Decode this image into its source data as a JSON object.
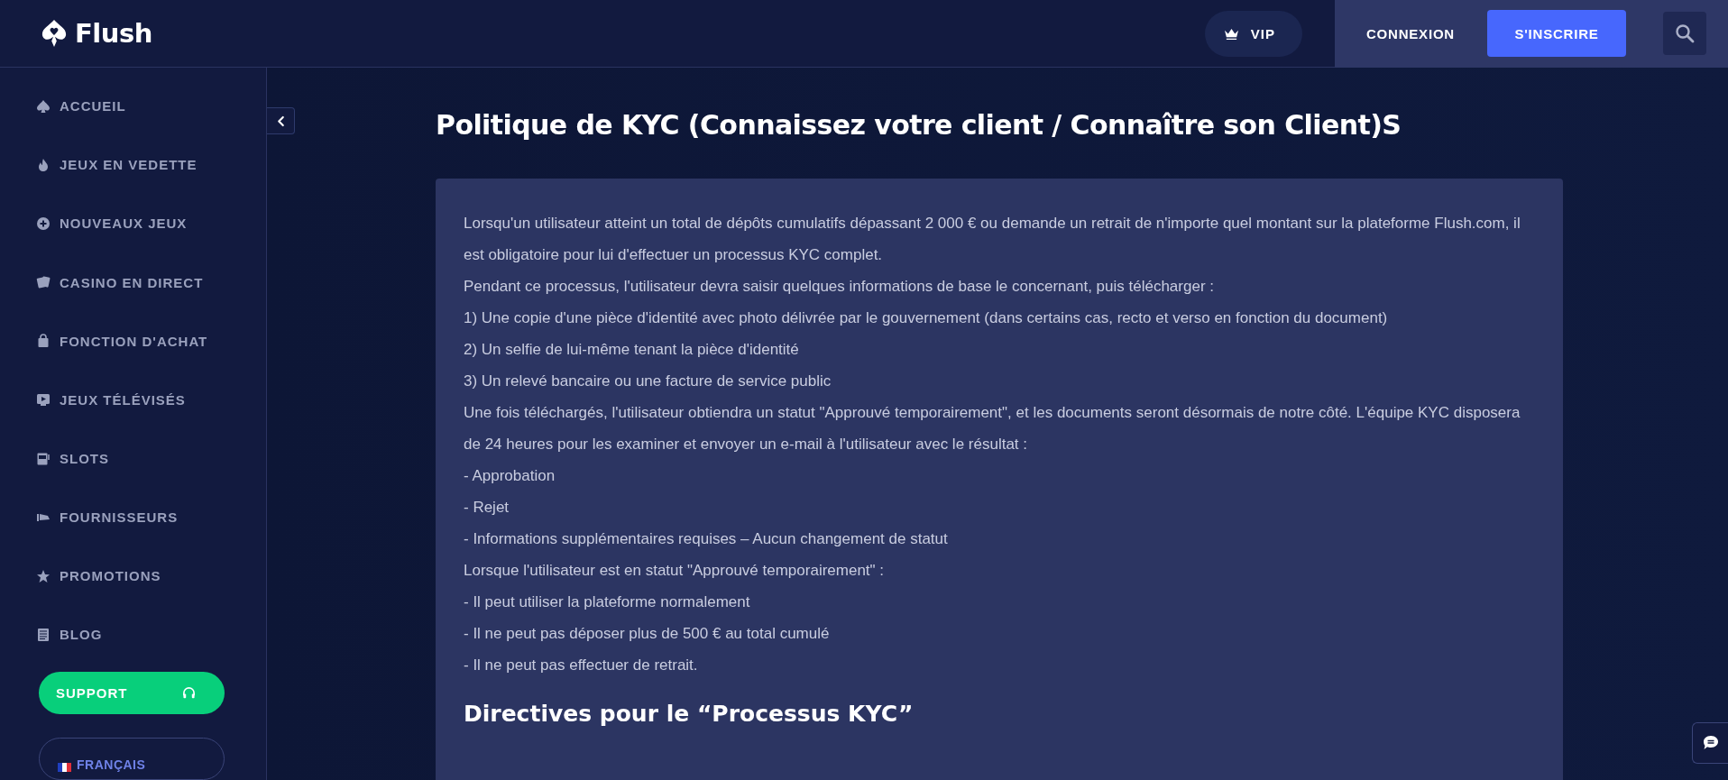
{
  "header": {
    "logo": "Flush",
    "vip": "VIP",
    "login": "CONNEXION",
    "signup": "S'INSCRIRE"
  },
  "sidebar": {
    "items": [
      {
        "label": "ACCUEIL"
      },
      {
        "label": "JEUX EN VEDETTE"
      },
      {
        "label": "NOUVEAUX JEUX"
      },
      {
        "label": "CASINO EN DIRECT"
      },
      {
        "label": "FONCTION D'ACHAT"
      },
      {
        "label": "JEUX TÉLÉVISÉS"
      },
      {
        "label": "SLOTS"
      },
      {
        "label": "FOURNISSEURS"
      },
      {
        "label": "PROMOTIONS"
      },
      {
        "label": "BLOG"
      }
    ],
    "support": "SUPPORT",
    "language": "FRANÇAIS"
  },
  "page": {
    "title": "Politique de KYC (Connaissez votre client / Connaître son Client)S",
    "paragraphs": [
      "Lorsqu'un utilisateur atteint un total de dépôts cumulatifs dépassant 2 000 € ou demande un retrait de n'importe quel montant sur la plateforme Flush.com, il est obligatoire pour lui d'effectuer un processus KYC complet.",
      "Pendant ce processus, l'utilisateur devra saisir quelques informations de base le concernant, puis télécharger :",
      "1) Une copie d'une pièce d'identité avec photo délivrée par le gouvernement (dans certains cas, recto et verso en fonction du document)",
      "2) Un selfie de lui-même tenant la pièce d'identité",
      "3) Un relevé bancaire ou une facture de service public",
      "Une fois téléchargés, l'utilisateur obtiendra un statut \"Approuvé temporairement\", et les documents seront désormais de notre côté. L'équipe KYC disposera de 24 heures pour les examiner et envoyer un e-mail à l'utilisateur avec le résultat :",
      "- Approbation",
      "- Rejet",
      "- Informations supplémentaires requises – Aucun changement de statut",
      "Lorsque l'utilisateur est en statut \"Approuvé temporairement\" :",
      "- Il peut utiliser la plateforme normalement",
      "- Il ne peut pas déposer plus de 500 € au total cumulé",
      "- Il ne peut pas effectuer de retrait."
    ],
    "subheading": "Directives pour le “Processus KYC”"
  }
}
